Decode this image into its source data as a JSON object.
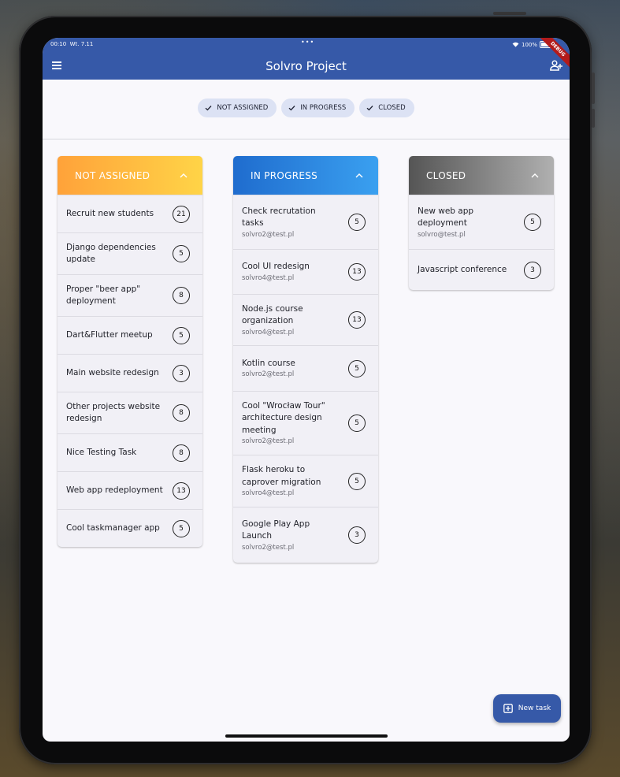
{
  "status": {
    "time": "00:10",
    "date": "Wt. 7.11",
    "dots": "•••",
    "battery": "100%",
    "debug_banner": "DEBUG"
  },
  "appbar": {
    "title": "Solvro Project"
  },
  "filters": [
    {
      "label": "NOT ASSIGNED"
    },
    {
      "label": "IN PROGRESS"
    },
    {
      "label": "CLOSED"
    }
  ],
  "colors": {
    "appbar": "#3659a8",
    "not_assigned": [
      "#ffa23a",
      "#ffd447"
    ],
    "in_progress": [
      "#1f6cce",
      "#3aa0f0"
    ],
    "closed": [
      "#555555",
      "#b0b0b0"
    ]
  },
  "columns": [
    {
      "title": "NOT ASSIGNED",
      "tasks": [
        {
          "title": "Recruit new students",
          "points": "21"
        },
        {
          "title": "Django dependencies update",
          "points": "5"
        },
        {
          "title": "Proper \"beer app\" deployment",
          "points": "8"
        },
        {
          "title": "Dart&Flutter meetup",
          "points": "5"
        },
        {
          "title": "Main website redesign",
          "points": "3"
        },
        {
          "title": "Other projects website redesign",
          "points": "8"
        },
        {
          "title": "Nice Testing Task",
          "points": "8"
        },
        {
          "title": "Web app redeployment",
          "points": "13"
        },
        {
          "title": "Cool taskmanager app",
          "points": "5"
        }
      ]
    },
    {
      "title": "IN PROGRESS",
      "tasks": [
        {
          "title": "Check recrutation tasks",
          "email": "solvro2@test.pl",
          "points": "5"
        },
        {
          "title": "Cool UI redesign",
          "email": "solvro4@test.pl",
          "points": "13"
        },
        {
          "title": "Node.js course organization",
          "email": "solvro4@test.pl",
          "points": "13"
        },
        {
          "title": "Kotlin course",
          "email": "solvro2@test.pl",
          "points": "5"
        },
        {
          "title": "Cool \"Wrocław Tour\" architecture design meeting",
          "email": "solvro2@test.pl",
          "points": "5"
        },
        {
          "title": "Flask heroku to caprover migration",
          "email": "solvro4@test.pl",
          "points": "5"
        },
        {
          "title": "Google Play App Launch",
          "email": "solvro2@test.pl",
          "points": "3"
        }
      ]
    },
    {
      "title": "CLOSED",
      "tasks": [
        {
          "title": "New web app deployment",
          "email": "solvro@test.pl",
          "points": "5"
        },
        {
          "title": "Javascript conference",
          "points": "3"
        }
      ]
    }
  ],
  "fab": {
    "label": "New task"
  }
}
